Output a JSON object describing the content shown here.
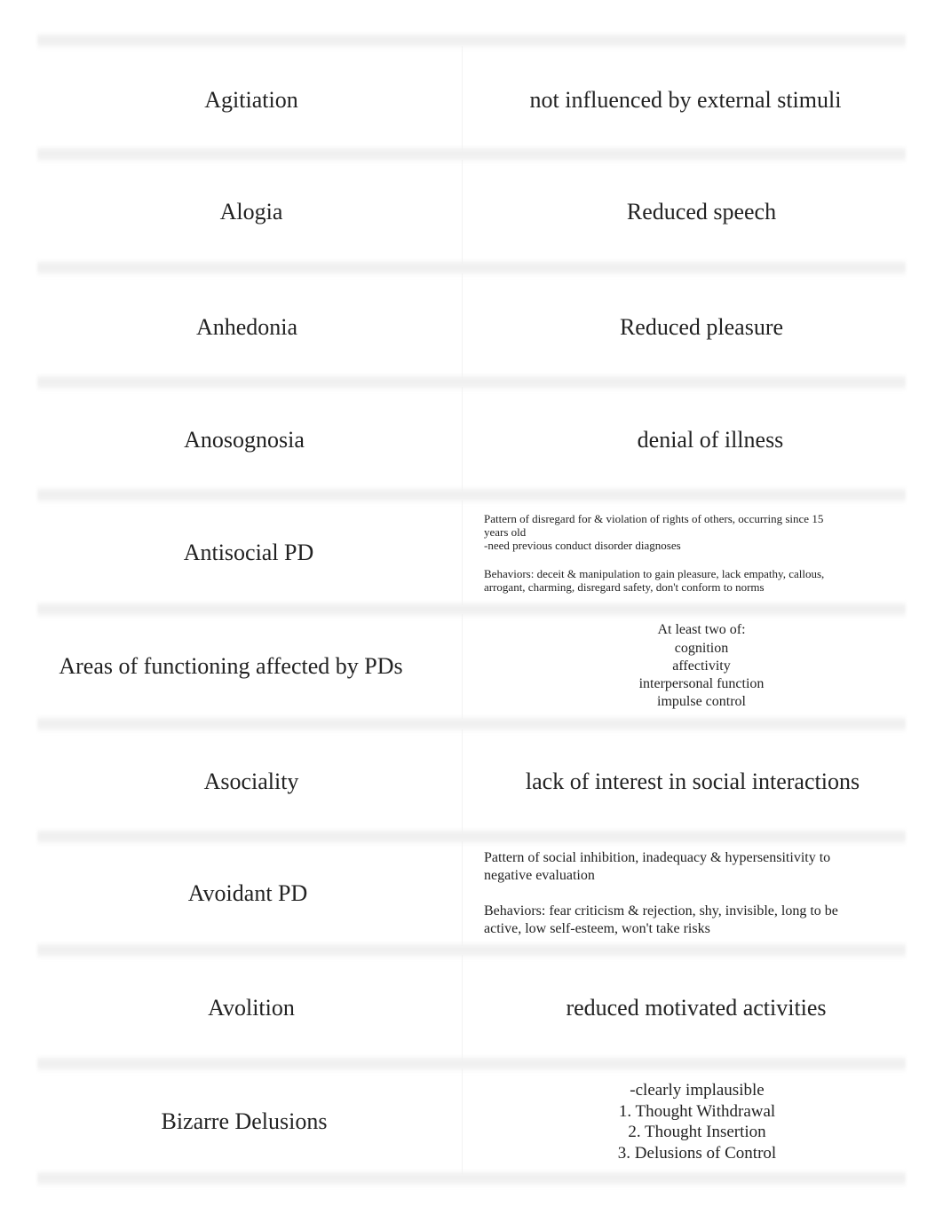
{
  "flashcards": [
    {
      "term": "Agitiation",
      "definition": "not influenced by external stimuli"
    },
    {
      "term": "Alogia",
      "definition": "Reduced speech"
    },
    {
      "term": "Anhedonia",
      "definition": "Reduced pleasure"
    },
    {
      "term": "Anosognosia",
      "definition": "denial of illness"
    },
    {
      "term": "Antisocial PD",
      "definition_lines": [
        "Pattern of disregard for & violation of rights of others, occurring since 15 years old",
        "-need previous conduct disorder diagnoses",
        "Behaviors: deceit & manipulation to gain pleasure, lack empathy, callous, arrogant, charming, disregard safety, don't conform to norms"
      ]
    },
    {
      "term": "Areas of functioning affected by PDs",
      "definition_lines": [
        "At least two of:",
        "cognition",
        "affectivity",
        "interpersonal function",
        "impulse control"
      ]
    },
    {
      "term": "Asociality",
      "definition": "lack of interest in social interactions"
    },
    {
      "term": "Avoidant PD",
      "definition_lines": [
        "Pattern of social inhibition, inadequacy & hypersensitivity to negative evaluation",
        "Behaviors: fear criticism & rejection, shy, invisible, long to be active, low self-esteem, won't take risks"
      ]
    },
    {
      "term": "Avolition",
      "definition": "reduced motivated activities"
    },
    {
      "term": "Bizarre Delusions",
      "definition_lines": [
        "-clearly implausible",
        "1. Thought Withdrawal",
        "2. Thought Insertion",
        "3. Delusions of Control"
      ]
    }
  ]
}
